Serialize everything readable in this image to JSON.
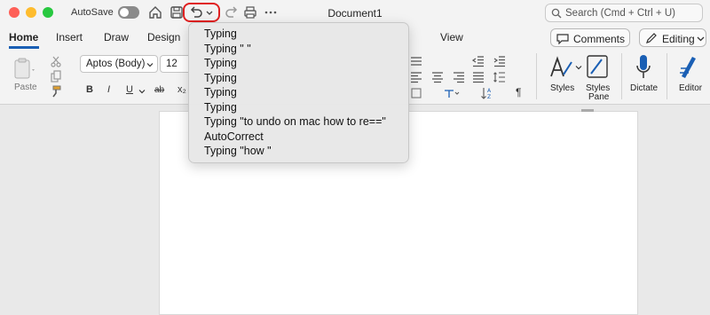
{
  "titlebar": {
    "autosave_label": "AutoSave",
    "document_title": "Document1",
    "search_placeholder": "Search (Cmd + Ctrl + U)"
  },
  "tabs": [
    "Home",
    "Insert",
    "Draw",
    "Design",
    "View"
  ],
  "right_buttons": {
    "comments": "Comments",
    "editing": "Editing"
  },
  "ribbon": {
    "paste_label": "Paste",
    "font_name": "Aptos (Body)",
    "font_size": "12",
    "format_buttons": [
      "B",
      "I",
      "U",
      "ab",
      "x₂"
    ],
    "styles_label": "Styles",
    "styles_pane_label": [
      "Styles",
      "Pane"
    ],
    "dictate_label": "Dictate",
    "editor_label": "Editor"
  },
  "undo_menu": {
    "items": [
      "Typing",
      "Typing \" \"",
      "Typing",
      "Typing",
      "Typing",
      "Typing",
      "Typing \"to undo on mac how to re==\"",
      "AutoCorrect",
      "Typing \"how \""
    ]
  },
  "colors": {
    "highlight": "#e02020",
    "active_tab_underline": "#1a5fb4",
    "ribbon_icon_blue": "#1a5fb4"
  }
}
